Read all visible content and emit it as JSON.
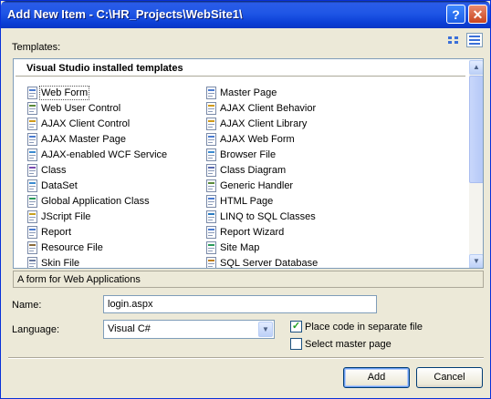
{
  "window": {
    "title": "Add New Item - C:\\HR_Projects\\WebSite1\\",
    "help_glyph": "?",
    "close_glyph": "✕"
  },
  "templates": {
    "label": "Templates:",
    "header": "Visual Studio installed templates",
    "left_column": [
      {
        "label": "Web Form",
        "icon": "web-form-icon",
        "selected": true
      },
      {
        "label": "Web User Control",
        "icon": "user-control-icon"
      },
      {
        "label": "AJAX Client Control",
        "icon": "ajax-client-control-icon"
      },
      {
        "label": "AJAX Master Page",
        "icon": "ajax-master-page-icon"
      },
      {
        "label": "AJAX-enabled WCF Service",
        "icon": "wcf-service-icon"
      },
      {
        "label": "Class",
        "icon": "class-icon"
      },
      {
        "label": "DataSet",
        "icon": "dataset-icon"
      },
      {
        "label": "Global Application Class",
        "icon": "global-app-icon"
      },
      {
        "label": "JScript File",
        "icon": "jscript-icon"
      },
      {
        "label": "Report",
        "icon": "report-icon"
      },
      {
        "label": "Resource File",
        "icon": "resource-file-icon"
      },
      {
        "label": "Skin File",
        "icon": "skin-file-icon"
      }
    ],
    "right_column": [
      {
        "label": "Master Page",
        "icon": "master-page-icon"
      },
      {
        "label": "AJAX Client Behavior",
        "icon": "ajax-client-behavior-icon"
      },
      {
        "label": "AJAX Client Library",
        "icon": "ajax-client-library-icon"
      },
      {
        "label": "AJAX Web Form",
        "icon": "ajax-web-form-icon"
      },
      {
        "label": "Browser File",
        "icon": "browser-file-icon"
      },
      {
        "label": "Class Diagram",
        "icon": "class-diagram-icon"
      },
      {
        "label": "Generic Handler",
        "icon": "generic-handler-icon"
      },
      {
        "label": "HTML Page",
        "icon": "html-page-icon"
      },
      {
        "label": "LINQ to SQL Classes",
        "icon": "linq-icon"
      },
      {
        "label": "Report Wizard",
        "icon": "report-wizard-icon"
      },
      {
        "label": "Site Map",
        "icon": "site-map-icon"
      },
      {
        "label": "SQL Server Database",
        "icon": "sql-database-icon"
      }
    ],
    "description": "A form for Web Applications"
  },
  "form": {
    "name_label": "Name:",
    "name_value": "login.aspx",
    "language_label": "Language:",
    "language_value": "Visual C#",
    "place_code_label": "Place code in separate file",
    "place_code_checked": true,
    "master_page_label": "Select master page",
    "master_page_checked": false
  },
  "buttons": {
    "add": "Add",
    "cancel": "Cancel"
  },
  "colors": {
    "titlebar": "#0b3fd6",
    "dialog_bg": "#ece9d8",
    "check_green": "#21a121"
  }
}
